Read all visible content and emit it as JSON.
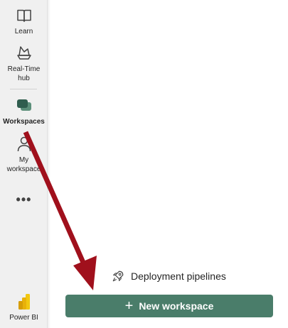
{
  "nav": {
    "learn": {
      "label": "Learn",
      "icon": "book-icon"
    },
    "realtime": {
      "label_line1": "Real-Time",
      "label_line2": "hub",
      "icon": "realtime-hub-icon"
    },
    "workspaces": {
      "label": "Workspaces",
      "icon": "workspaces-icon"
    },
    "my_workspace": {
      "label_line1": "My",
      "label_line2": "workspace",
      "icon": "person-icon"
    },
    "more": {
      "label": "•••",
      "icon": "more-icon"
    },
    "powerbi": {
      "label": "Power BI",
      "icon": "powerbi-logo-icon"
    }
  },
  "main": {
    "deploy_label": "Deployment pipelines",
    "deploy_icon": "rocket-icon",
    "new_workspace_plus": "+",
    "new_workspace_label": "New workspace"
  },
  "colors": {
    "primary_button": "#4a7d6a",
    "annotation_arrow": "#a0101c",
    "powerbi_yellow": "#f2c811"
  }
}
